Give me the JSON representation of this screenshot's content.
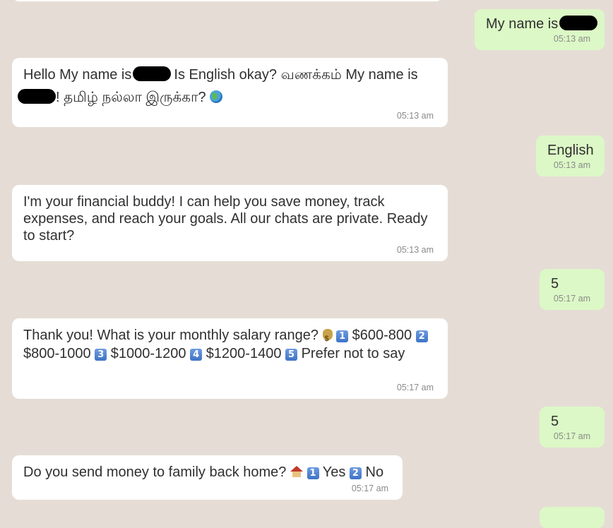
{
  "messages": [
    {
      "dir": "out",
      "text": "My name is",
      "time": "05:13 am",
      "redacted": true
    },
    {
      "dir": "in",
      "text_a": "Hello My name is",
      "text_b": "Is English okay? வணக்கம் My name is",
      "text_c": "! தமிழ் நல்லா இருக்கா?",
      "emoji": "globe",
      "time": "05:13 am"
    },
    {
      "dir": "out",
      "text": "English",
      "time": "05:13 am"
    },
    {
      "dir": "in",
      "text": "I'm your financial buddy! I can help you save money, track expenses, and reach your goals. All our chats are private. Ready to start?",
      "time": "05:13 am"
    },
    {
      "dir": "out",
      "text": "5",
      "time": "05:17 am"
    },
    {
      "dir": "in",
      "text_a": "Thank you! What is your monthly salary range?",
      "emoji": "money-bag",
      "options": [
        {
          "key": "1",
          "label": "$600-800"
        },
        {
          "key": "2",
          "label": "$800-1000"
        },
        {
          "key": "3",
          "label": "$1000-1200"
        },
        {
          "key": "4",
          "label": "$1200-1400"
        },
        {
          "key": "5",
          "label": "Prefer not to say"
        }
      ],
      "time": "05:17 am"
    },
    {
      "dir": "out",
      "text": "5",
      "time": "05:17 am"
    },
    {
      "dir": "in",
      "text_a": "Do you send money to family back home?",
      "emoji": "house",
      "options": [
        {
          "key": "1",
          "label": "Yes"
        },
        {
          "key": "2",
          "label": "No"
        }
      ],
      "time": "05:17 am"
    }
  ]
}
